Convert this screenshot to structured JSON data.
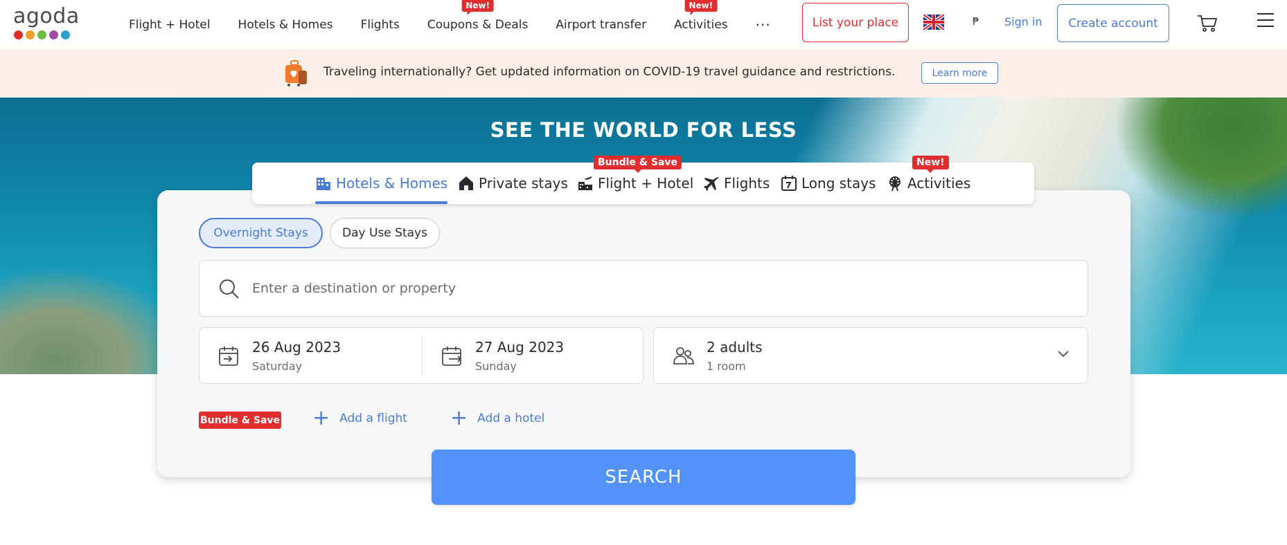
{
  "logo": {
    "text": "agoda",
    "dot_colors": [
      "#e12d2d",
      "#f0a12b",
      "#6fba45",
      "#a24aa8",
      "#2a9fd0"
    ]
  },
  "nav": {
    "items": [
      {
        "label": "Flight + Hotel",
        "badge": ""
      },
      {
        "label": "Hotels & Homes",
        "badge": ""
      },
      {
        "label": "Flights",
        "badge": ""
      },
      {
        "label": "Coupons & Deals",
        "badge": "New!"
      },
      {
        "label": "Airport transfer",
        "badge": ""
      },
      {
        "label": "Activities",
        "badge": "New!"
      }
    ],
    "more": "···",
    "list_your_place": "List your place",
    "currency": "₱",
    "sign_in": "Sign in",
    "create_account": "Create account",
    "language_icon": "uk-flag-icon",
    "cart_icon": "cart-icon",
    "menu_icon": "hamburger-icon"
  },
  "banner": {
    "text": "Traveling internationally? Get updated information on COVID-19 travel guidance and restrictions.",
    "button": "Learn more",
    "icon": "luggage-heart-icon"
  },
  "hero": {
    "title": "SEE THE WORLD FOR LESS"
  },
  "tabs": [
    {
      "label": "Hotels & Homes",
      "icon": "building-icon",
      "active": true,
      "badge": ""
    },
    {
      "label": "Private stays",
      "icon": "house-icon",
      "active": false,
      "badge": ""
    },
    {
      "label": "Flight + Hotel",
      "icon": "flight-hotel-icon",
      "active": false,
      "badge": "Bundle & Save"
    },
    {
      "label": "Flights",
      "icon": "plane-icon",
      "active": false,
      "badge": ""
    },
    {
      "label": "Long stays",
      "icon": "calendar-7-icon",
      "active": false,
      "badge": ""
    },
    {
      "label": "Activities",
      "icon": "ferris-wheel-icon",
      "active": false,
      "badge": "New!"
    }
  ],
  "search": {
    "stay_types": {
      "overnight": "Overnight Stays",
      "day_use": "Day Use Stays",
      "selected": "overnight"
    },
    "destination_placeholder": "Enter a destination or property",
    "destination_value": "",
    "check_in": {
      "date": "26 Aug 2023",
      "day": "Saturday"
    },
    "check_out": {
      "date": "27 Aug 2023",
      "day": "Sunday"
    },
    "guests": {
      "main": "2 adults",
      "sub": "1 room"
    },
    "bundle_badge": "Bundle & Save",
    "add_flight": "Add a flight",
    "add_hotel": "Add a hotel",
    "submit": "SEARCH"
  },
  "colors": {
    "accent_blue": "#4a7bd6",
    "search_button": "#5392f9",
    "badge_red": "#e12d2d",
    "banner_bg": "#fcefe7"
  }
}
